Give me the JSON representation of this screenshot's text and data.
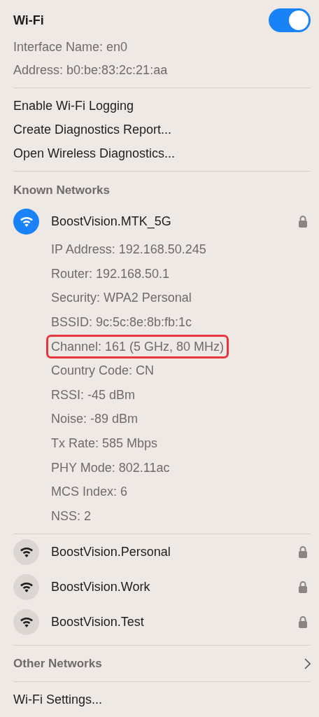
{
  "header": {
    "title": "Wi-Fi",
    "on": true
  },
  "interface_info": [
    "Interface Name: en0",
    "Address: b0:be:83:2c:21:aa"
  ],
  "menu_items": [
    "Enable Wi-Fi Logging",
    "Create Diagnostics Report...",
    "Open Wireless Diagnostics..."
  ],
  "known_networks": {
    "heading": "Known Networks",
    "networks": [
      {
        "name": "BoostVision.MTK_5G",
        "selected": true,
        "locked": true,
        "details": [
          {
            "text": "IP Address: 192.168.50.245",
            "highlighted": false
          },
          {
            "text": "Router: 192.168.50.1",
            "highlighted": false
          },
          {
            "text": "Security: WPA2 Personal",
            "highlighted": false
          },
          {
            "text": "BSSID: 9c:5c:8e:8b:fb:1c",
            "highlighted": false
          },
          {
            "text": "Channel: 161 (5 GHz, 80 MHz)",
            "highlighted": true
          },
          {
            "text": "Country Code: CN",
            "highlighted": false
          },
          {
            "text": "RSSI: -45 dBm",
            "highlighted": false
          },
          {
            "text": "Noise: -89 dBm",
            "highlighted": false
          },
          {
            "text": "Tx Rate: 585 Mbps",
            "highlighted": false
          },
          {
            "text": "PHY Mode: 802.11ac",
            "highlighted": false
          },
          {
            "text": "MCS Index: 6",
            "highlighted": false
          },
          {
            "text": "NSS: 2",
            "highlighted": false
          }
        ]
      },
      {
        "name": "BoostVision.Personal",
        "selected": false,
        "locked": true
      },
      {
        "name": "BoostVision.Work",
        "selected": false,
        "locked": true
      },
      {
        "name": "BoostVision.Test",
        "selected": false,
        "locked": true
      }
    ]
  },
  "other_networks": {
    "label": "Other Networks"
  },
  "footer": {
    "label": "Wi-Fi Settings..."
  }
}
